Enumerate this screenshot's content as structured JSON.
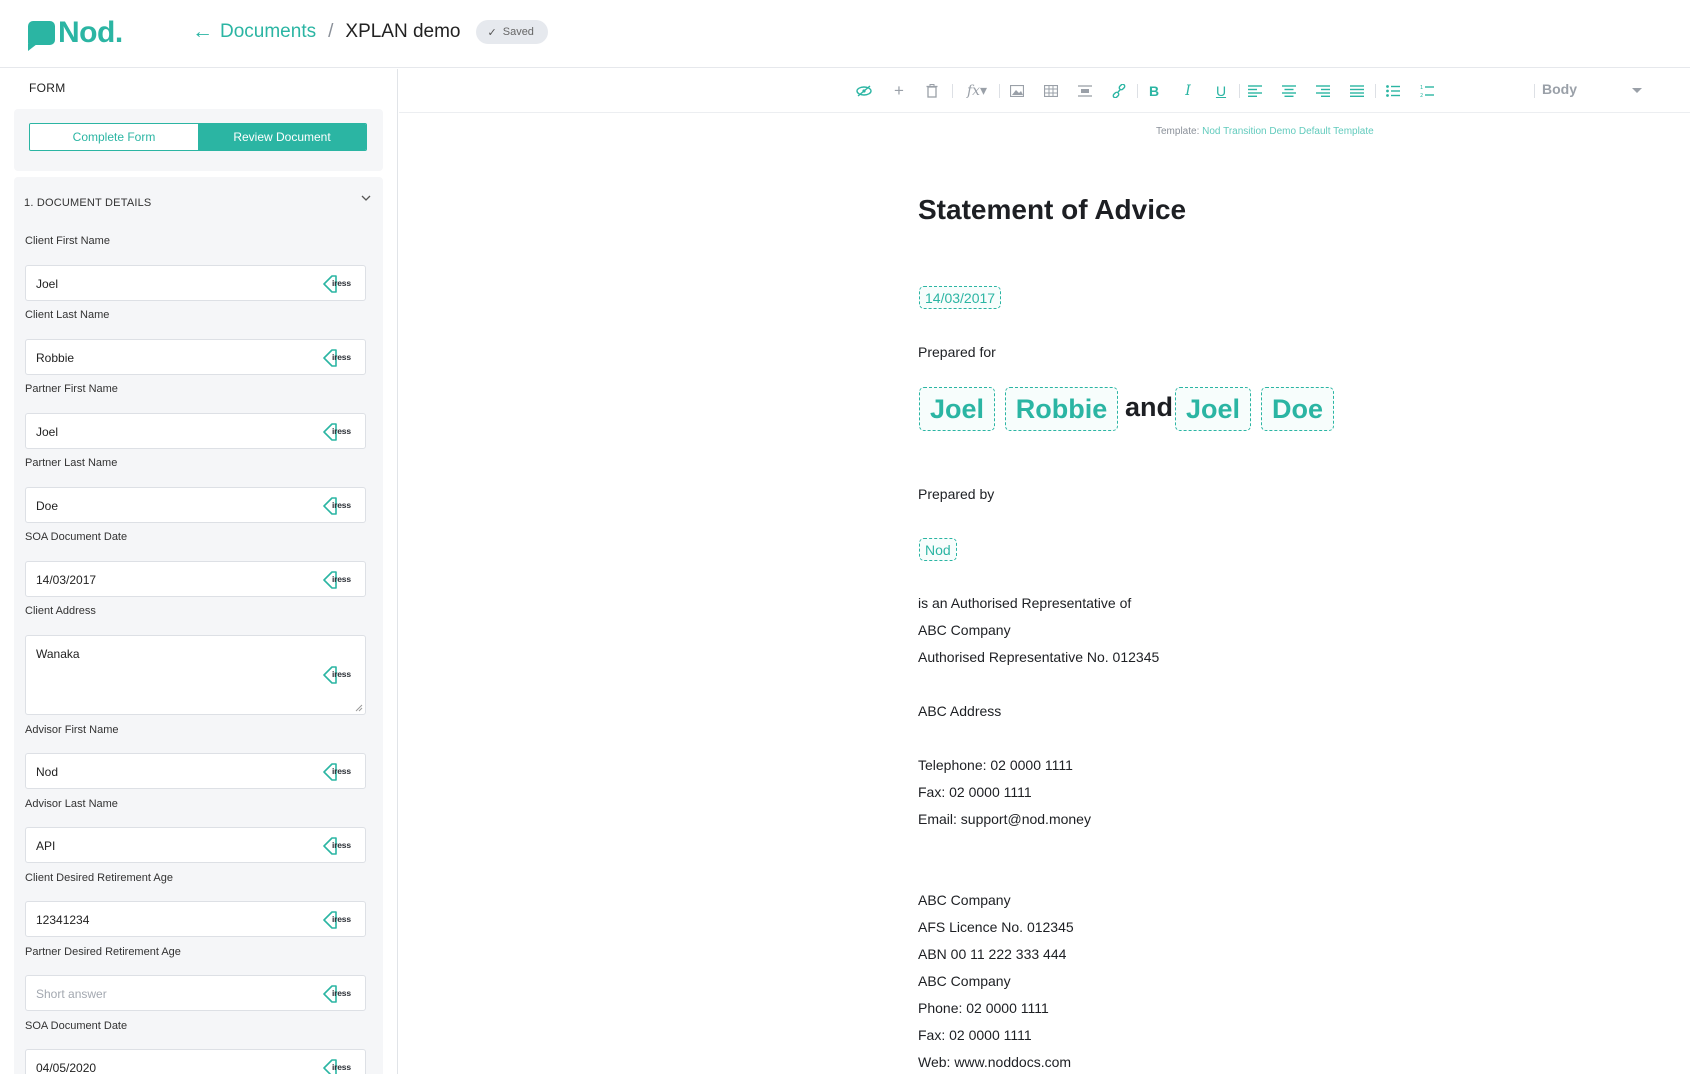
{
  "brand": {
    "logo_text": "Nod.",
    "accent": "#2bb5a3"
  },
  "breadcrumb": {
    "back_label": "Documents",
    "separator": "/",
    "current": "XPLAN demo",
    "status": "Saved"
  },
  "left_panel": {
    "title": "FORM",
    "toggle": {
      "complete_label": "Complete Form",
      "review_label": "Review Document",
      "active": "Review Document"
    },
    "section_title": "1. DOCUMENT DETAILS",
    "integration_label": "iress",
    "fields": [
      {
        "label": "Client First Name",
        "value": "Joel",
        "placeholder": ""
      },
      {
        "label": "Client Last Name",
        "value": "Robbie",
        "placeholder": ""
      },
      {
        "label": "Partner First Name",
        "value": "Joel",
        "placeholder": ""
      },
      {
        "label": "Partner Last Name",
        "value": "Doe",
        "placeholder": ""
      },
      {
        "label": "SOA Document Date",
        "value": "14/03/2017",
        "placeholder": ""
      },
      {
        "label": "Client Address",
        "value": "Wanaka",
        "placeholder": ""
      },
      {
        "label": "Advisor First Name",
        "value": "Nod",
        "placeholder": ""
      },
      {
        "label": "Advisor Last Name",
        "value": "API",
        "placeholder": ""
      },
      {
        "label": "Client Desired Retirement Age",
        "value": "12341234",
        "placeholder": ""
      },
      {
        "label": "Partner Desired Retirement Age",
        "value": "",
        "placeholder": "Short answer"
      },
      {
        "label": "SOA Document Date",
        "value": "04/05/2020",
        "placeholder": ""
      }
    ]
  },
  "toolbar": {
    "icons": [
      "hide-icon",
      "plus-icon",
      "trash-icon",
      "function-icon",
      "image-icon",
      "table-icon",
      "divider-icon",
      "link-icon",
      "bold-icon",
      "italic-icon",
      "underline-icon",
      "align-left-icon",
      "align-center-icon",
      "align-right-icon",
      "align-justify-icon",
      "bullet-list-icon",
      "numbered-list-icon"
    ],
    "style_value": "Body"
  },
  "document": {
    "template_prefix": "Template:",
    "template_name": "Nod Transition Demo Default Template",
    "title": "Statement of Advice",
    "date_chip": "14/03/2017",
    "prepared_for_label": "Prepared for",
    "client_first": "Joel",
    "client_last": "Robbie",
    "and_word": "and",
    "partner_first": "Joel",
    "partner_last": "Doe",
    "prepared_by_label": "Prepared by",
    "advisor_chip": "Nod",
    "lines": [
      "is an Authorised Representative of",
      "ABC Company",
      "Authorised Representative No. 012345",
      "ABC Address",
      "Telephone:  02 0000 1111",
      "Fax:  02 0000 1111",
      "Email: support@nod.money",
      "ABC Company",
      "AFS Licence No. 012345",
      "ABN 00 11 222 333 444",
      "ABC Company",
      "Phone: 02 0000 1111",
      "Fax: 02 0000 1111",
      "Web: www.noddocs.com"
    ]
  }
}
